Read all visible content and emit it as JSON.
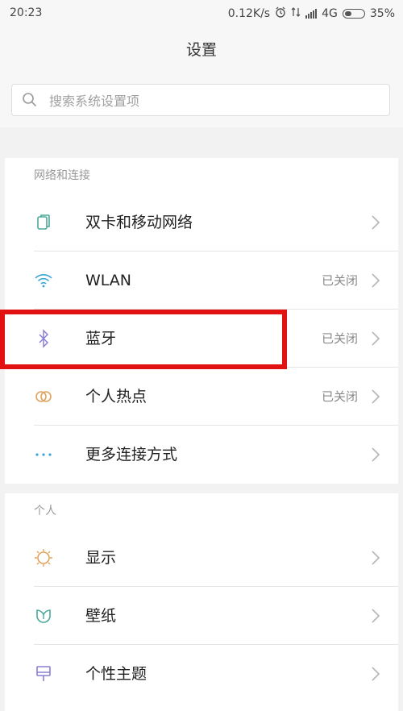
{
  "status_bar": {
    "time": "20:23",
    "net_speed": "0.12K/s",
    "network_type": "4G",
    "battery": "35%",
    "icons": [
      "alarm-icon",
      "data-arrows-icon",
      "signal-icon",
      "battery-icon"
    ]
  },
  "header": {
    "title": "设置"
  },
  "search": {
    "placeholder": "搜索系统设置项"
  },
  "sections": [
    {
      "title": "网络和连接",
      "items": [
        {
          "label": "双卡和移动网络",
          "value": "",
          "icon": "dual-sim-icon",
          "color": "#4aa89a"
        },
        {
          "label": "WLAN",
          "value": "已关闭",
          "icon": "wifi-icon",
          "color": "#3aa6d6"
        },
        {
          "label": "蓝牙",
          "value": "已关闭",
          "icon": "bluetooth-icon",
          "color": "#8a7fd6"
        },
        {
          "label": "个人热点",
          "value": "已关闭",
          "icon": "hotspot-icon",
          "color": "#e0a35c"
        },
        {
          "label": "更多连接方式",
          "value": "",
          "icon": "more-dots-icon",
          "color": "#3aa6d6"
        }
      ]
    },
    {
      "title": "个人",
      "items": [
        {
          "label": "显示",
          "value": "",
          "icon": "brightness-icon",
          "color": "#e0a35c"
        },
        {
          "label": "壁纸",
          "value": "",
          "icon": "wallpaper-icon",
          "color": "#4aa89a"
        },
        {
          "label": "个性主题",
          "value": "",
          "icon": "theme-icon",
          "color": "#8a7fd6"
        }
      ]
    }
  ],
  "highlight_color": "#e21212"
}
